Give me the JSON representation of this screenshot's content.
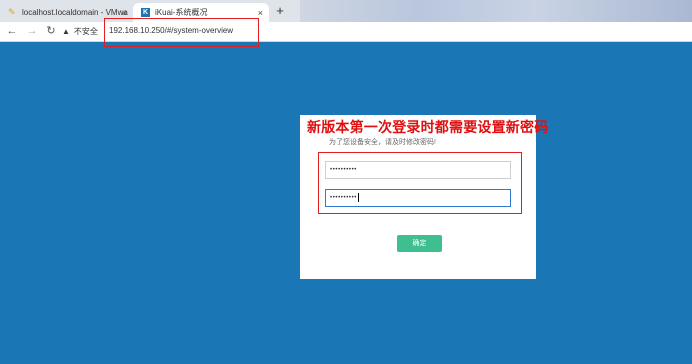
{
  "browser": {
    "tabs": [
      {
        "title": "localhost.localdomain - VMwa",
        "close": "×"
      },
      {
        "title": "iKuai-系统概况",
        "close": "×"
      }
    ],
    "new_tab": "+",
    "security_label": "不安全",
    "url": "192.168.10.250/#/system-overview",
    "icons": {
      "back": "back-arrow-icon",
      "forward": "forward-arrow-icon",
      "reload": "reload-icon",
      "warning": "warning-icon"
    }
  },
  "login": {
    "annotation": "新版本第一次登录时都需要设置新密码",
    "subtitle": "为了您设备安全，请及时修改密码!",
    "password1": "••••••••••",
    "password2": "••••••••••",
    "confirm_label": "确定"
  },
  "colors": {
    "background": "#1b76b5",
    "highlight": "#e02020",
    "button": "#3fbf8f"
  }
}
